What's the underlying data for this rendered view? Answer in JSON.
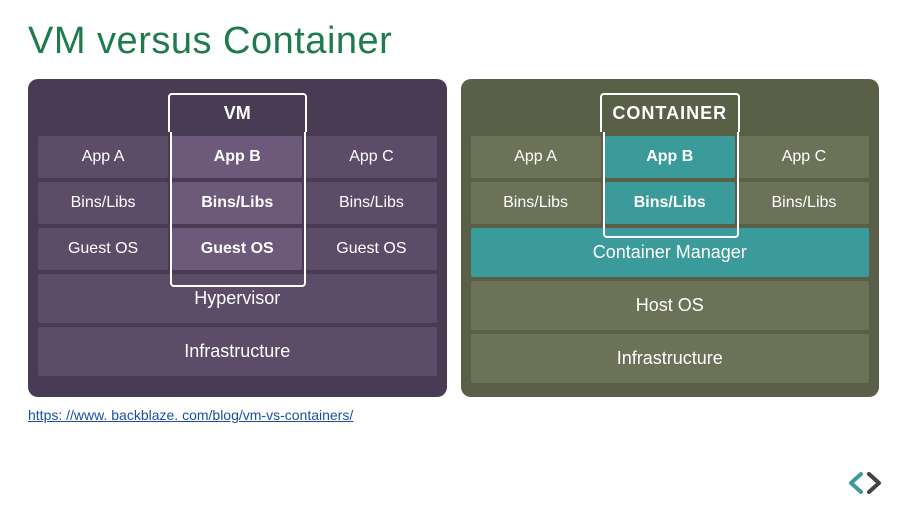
{
  "title": "VM versus Container",
  "vm": {
    "header": "VM",
    "rows": [
      [
        "App A",
        "App B",
        "App C"
      ],
      [
        "Bins/Libs",
        "Bins/Libs",
        "Bins/Libs"
      ],
      [
        "Guest OS",
        "Guest OS",
        "Guest OS"
      ]
    ],
    "full": [
      "Hypervisor",
      "Infrastructure"
    ],
    "highlight_col": 1
  },
  "container": {
    "header": "CONTAINER",
    "rows": [
      [
        "App A",
        "App B",
        "App C"
      ],
      [
        "Bins/Libs",
        "Bins/Libs",
        "Bins/Libs"
      ]
    ],
    "full": [
      "Container Manager",
      "Host OS",
      "Infrastructure"
    ],
    "highlight_col": 1
  },
  "source_link": "https: //www. backblaze. com/blog/vm-vs-containers/",
  "colors": {
    "title": "#1f7a4d",
    "vm_bg": "#4a3b55",
    "vm_cell": "#5c4c68",
    "vm_hl": "#6d597a",
    "ct_bg": "#5a6047",
    "ct_cell": "#6b7258",
    "ct_hl": "#3b9a9a"
  }
}
